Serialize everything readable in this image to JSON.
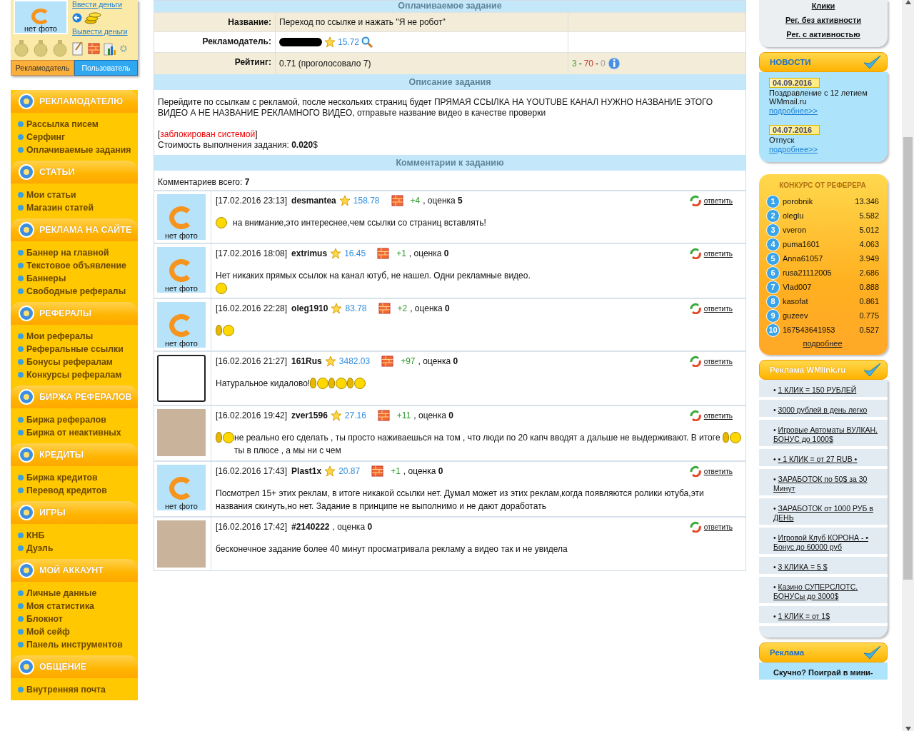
{
  "profile": {
    "photo_caption": "нет фото",
    "links": [
      "Ввести деньги",
      "Вывести деньги"
    ],
    "tabs": [
      {
        "label": "Рекламодатель",
        "selected": false
      },
      {
        "label": "Пользователь",
        "selected": true
      }
    ]
  },
  "menu": [
    {
      "title": "РЕКЛАМОДАТЕЛЮ",
      "items": [
        "Рассылка писем",
        "Серфинг",
        "Оплачиваемые задания"
      ]
    },
    {
      "title": "СТАТЬИ",
      "items": [
        "Мои статьи",
        "Магазин статей"
      ]
    },
    {
      "title": "РЕКЛАМА НА САЙТЕ",
      "items": [
        "Баннер на главной",
        "Текстовое объявление",
        "Баннеры",
        "Свободные рефералы"
      ]
    },
    {
      "title": "РЕФЕРАЛЫ",
      "items": [
        "Мои рефералы",
        "Реферальные ссылки",
        "Бонусы рефералам",
        "Конкурсы рефералам"
      ]
    },
    {
      "title": "БИРЖА РЕФЕРАЛОВ",
      "items": [
        "Биржа рефералов",
        "Биржа от неактивных"
      ]
    },
    {
      "title": "КРЕДИТЫ",
      "items": [
        "Биржа кредитов",
        "Перевод кредитов"
      ]
    },
    {
      "title": "ИГРЫ",
      "items": [
        "КНБ",
        "Дуэль"
      ]
    },
    {
      "title": "МОЙ АККАУНТ",
      "items": [
        "Личные данные",
        "Моя статистика",
        "Блокнот",
        "Мой сейф",
        "Панель инструментов"
      ]
    },
    {
      "title": "ОБЩЕНИЕ",
      "items": [
        "Внутренняя почта"
      ]
    }
  ],
  "task": {
    "title": "Оплачиваемое задание",
    "fields": [
      {
        "kind": "text",
        "label": "Название:",
        "value": "Переход по ссылке и нажать \"Я не робот\""
      },
      {
        "kind": "advertiser",
        "label": "Рекламодатель:",
        "value": "15.72"
      },
      {
        "kind": "rating",
        "label": "Рейтинг:",
        "value": "0.71 (проголосовало 7)",
        "separator": "-",
        "votes": [
          {
            "text": "3",
            "color": "#3fa33a"
          },
          {
            "text": "70",
            "color": "#c0392b"
          },
          {
            "text": "0",
            "color": "#a0a0a0"
          }
        ]
      }
    ]
  },
  "description": {
    "title": "Описание задания",
    "text": "Перейдите по ссылкам с рекламой, после нескольких страниц будет ПРЯМАЯ ССЫЛКА НА YOUTUBE КАНАЛ НУЖНО НАЗВАНИЕ ЭТОГО ВИДЕО А НЕ НАЗВАНИЕ РЕКЛАМНОГО ВИДЕО, отправьте название видео в качестве проверки",
    "blocked": [
      {
        "kind": "bracket",
        "text": "["
      },
      {
        "kind": "message",
        "text": "заблокирован системой"
      },
      {
        "kind": "bracket",
        "text": "]"
      }
    ],
    "cost": "Стоимость выполнения задания: **0.020**$"
  },
  "comments": {
    "title": "Комментарии к заданию",
    "total": "Комментариев всего: **7**",
    "items": [
      {
        "avatar": {
          "kind": "no_photo",
          "caption": "нет фото"
        },
        "date": "[17.02.2016 23:13]",
        "user": "desmantea",
        "rating": "158.78",
        "points": "+4",
        "grade_label": ", оценка",
        "grade": "5",
        "reply": "ответить",
        "body": [
          {
            "kind": "laugh"
          },
          {
            "kind": "text",
            "text": "на внимание,это интереснее,чем ссылки со страниц вставлять!"
          }
        ]
      },
      {
        "avatar": {
          "kind": "no_photo",
          "caption": "нет фото"
        },
        "date": "[17.02.2016 18:08]",
        "user": "extrimus",
        "rating": "16.45",
        "points": "+1",
        "grade_label": ", оценка",
        "grade": "0",
        "reply": "ответить",
        "body": [
          {
            "kind": "text",
            "text": "Нет никаких прямых ссылок на канал ютуб, не нашел. Одни рекламные видео."
          },
          {
            "kind": "break"
          },
          {
            "kind": "sad"
          }
        ]
      },
      {
        "avatar": {
          "kind": "no_photo",
          "caption": "нет фото"
        },
        "date": "[16.02.2016 22:28]",
        "user": "oleg1910",
        "rating": "83.78",
        "points": "+2",
        "grade_label": ", оценка",
        "grade": "0",
        "reply": "ответить",
        "body": [
          {
            "kind": "break"
          },
          {
            "kind": "ear"
          },
          {
            "kind": "smiley"
          }
        ]
      },
      {
        "avatar": {
          "kind": "plate"
        },
        "date": "[16.02.2016 21:27]",
        "user": "161Rus",
        "rating": "3482.03",
        "points": "+97",
        "grade_label": ", оценка",
        "grade": "0",
        "reply": "ответить",
        "body": [
          {
            "kind": "text",
            "text": "Натуральное кидалово!"
          },
          {
            "kind": "ear"
          },
          {
            "kind": "smiley"
          },
          {
            "kind": "ear"
          },
          {
            "kind": "smiley"
          },
          {
            "kind": "ear"
          },
          {
            "kind": "smiley"
          }
        ]
      },
      {
        "avatar": {
          "kind": "photo"
        },
        "date": "[16.02.2016 19:42]",
        "user": "zver1596",
        "rating": "27.16",
        "points": "+11",
        "grade_label": ", оценка",
        "grade": "0",
        "reply": "ответить",
        "body": [
          {
            "kind": "ear"
          },
          {
            "kind": "smiley"
          },
          {
            "kind": "text",
            "text": " не реально его сделать , ты просто наживаешься на том , что люди по 20 капч вводят а дальше не выдерживают. В итоге ты в плюсе , а мы ни с чем "
          },
          {
            "kind": "ear"
          },
          {
            "kind": "smiley"
          }
        ]
      },
      {
        "avatar": {
          "kind": "no_photo",
          "caption": "нет фото"
        },
        "date": "[16.02.2016 17:43]",
        "user": "Plast1x",
        "rating": "20.87",
        "points": "+1",
        "grade_label": ", оценка",
        "grade": "0",
        "reply": "ответить",
        "body": [
          {
            "kind": "text",
            "text": "Посмотрел 15+ этих реклам, в итоге никакой ссылки нет. Думал может из этих реклам,когда появляются ролики ютуба,эти названия скинуть,но нет. Задание в принципе не выполнимо и не дают доработать"
          }
        ]
      },
      {
        "avatar": {
          "kind": "photo"
        },
        "date": "[16.02.2016 17:42]",
        "user": "#2140222",
        "grade_label": ", оценка",
        "grade": "0",
        "reply": "ответить",
        "body": [
          {
            "kind": "text",
            "text": "бесконечное задание более 40 минут просматривала рекламу а видео так и не увидела"
          }
        ]
      }
    ]
  },
  "right": {
    "top_links": [
      "Клики",
      "Рег. без активности",
      "Рег. с активностью"
    ],
    "news": {
      "title": "НОВОСТИ",
      "items": [
        {
          "date": "04.09.2016",
          "text": "Поздравление с 12 летием WMmail.ru",
          "more": "подробнее>>"
        },
        {
          "date": "04.07.2016",
          "text": "Отпуск",
          "more": "подробнее>>"
        }
      ]
    },
    "contest": {
      "title": "КОНКУРС ОТ РЕФЕРЕРА",
      "rows": [
        {
          "rank": "1",
          "name": "porobnik",
          "value": "13.346"
        },
        {
          "rank": "2",
          "name": "oleglu",
          "value": "5.582"
        },
        {
          "rank": "3",
          "name": "vveron",
          "value": "5.012"
        },
        {
          "rank": "4",
          "name": "puma1601",
          "value": "4.063"
        },
        {
          "rank": "5",
          "name": "Anna61057",
          "value": "3.949"
        },
        {
          "rank": "6",
          "name": "rusa21112005",
          "value": "2.686"
        },
        {
          "rank": "7",
          "name": "Vlad007",
          "value": "0.888"
        },
        {
          "rank": "8",
          "name": "kasofat",
          "value": "0.861"
        },
        {
          "rank": "9",
          "name": "guzeev",
          "value": "0.775"
        },
        {
          "rank": "10",
          "name": "167543641953",
          "value": "0.527"
        }
      ],
      "more": "подробнее"
    },
    "ads": {
      "title": "Реклама WMlink.ru",
      "items": [
        {
          "bullet": "•",
          "text": "1 КЛИК = 150 РУБЛЕЙ"
        },
        {
          "bullet": "•",
          "text": "3000 рублей в день легко"
        },
        {
          "bullet": "•",
          "text": "Игровые Автоматы ВУЛКАН. БОНУС до 1000$"
        },
        {
          "bullet": "•",
          "text": "• 1 КЛИК = от 27 RUB •"
        },
        {
          "bullet": "•",
          "text": "ЗАРАБОТОК по 50$ за 30 Минут"
        },
        {
          "bullet": "•",
          "text": "ЗАРАБОТОК от 1000 РУБ в ДЕНЬ"
        },
        {
          "bullet": "•",
          "text": "Игровой Клуб КОРОНА - •  Бонус до 60000 руб"
        },
        {
          "bullet": "•",
          "text": "3 КЛИКА = 5 $"
        },
        {
          "bullet": "•",
          "text": "Казино СУПЕРСЛОТС. БОНУСы до 3000$"
        },
        {
          "bullet": "•",
          "text": "1 КЛИК = от 1$"
        }
      ]
    },
    "promo": {
      "title": "Реклама",
      "text": "Скучно? Поиграй в мини-"
    }
  }
}
